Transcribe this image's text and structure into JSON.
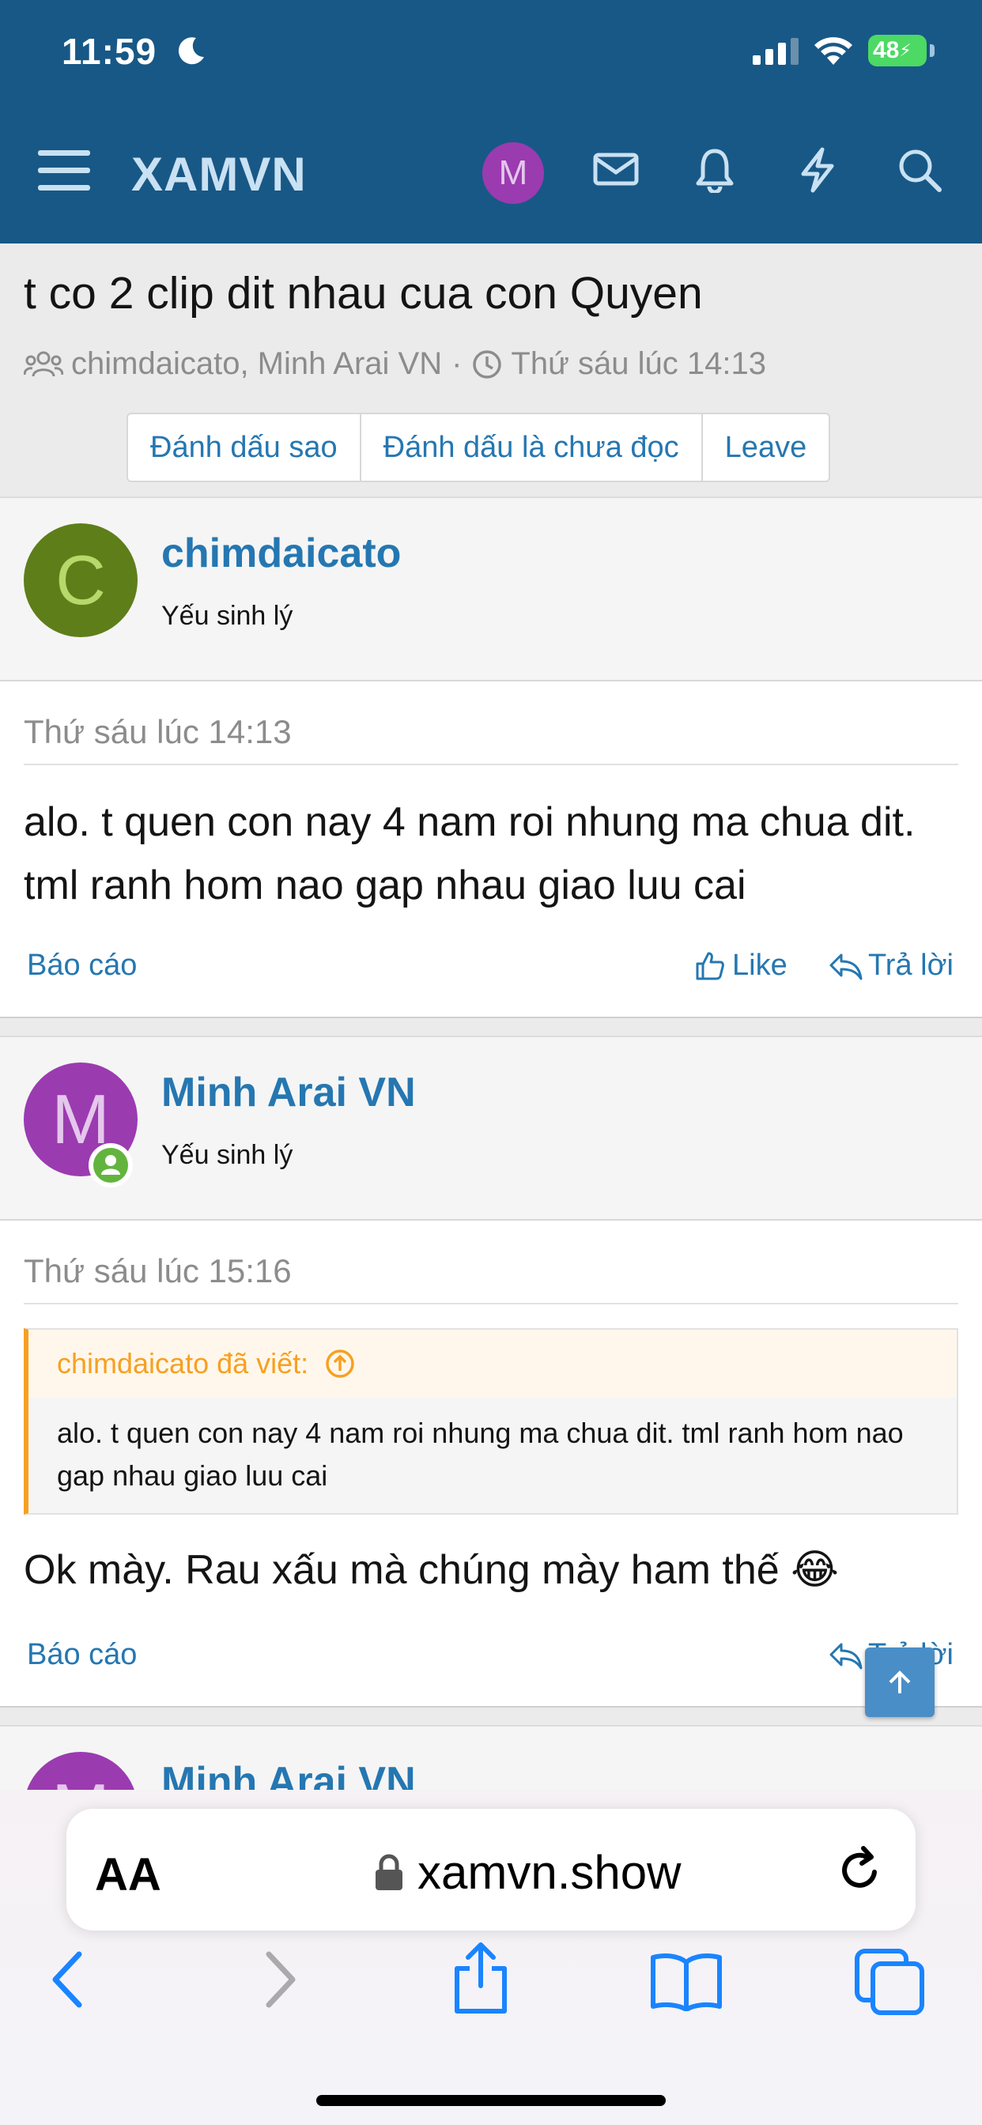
{
  "status": {
    "time": "11:59",
    "battery": "48"
  },
  "nav": {
    "logo": "XAMVN",
    "avatar_letter": "M"
  },
  "thread": {
    "title": "t co 2 clip dit nhau cua con Quyen",
    "participants": "chimdaicato, Minh Arai VN",
    "date": "Thứ sáu lúc 14:13",
    "buttons": [
      "Đánh dấu sao",
      "Đánh dấu là chưa đọc",
      "Leave"
    ]
  },
  "posts": [
    {
      "avatar_letter": "C",
      "username": "chimdaicato",
      "user_title": "Yếu sinh lý",
      "date": "Thứ sáu lúc 14:13",
      "text": "alo. t quen con nay 4 nam roi nhung ma chua dit. tml ranh hom nao gap nhau giao luu cai",
      "report": "Báo cáo",
      "like": "Like",
      "reply": "Trả lời"
    },
    {
      "avatar_letter": "M",
      "username": "Minh Arai VN",
      "user_title": "Yếu sinh lý",
      "date": "Thứ sáu lúc 15:16",
      "quote_author": "chimdaicato đã viết:",
      "quote_text": "alo. t quen con nay 4 nam roi nhung ma chua dit. tml ranh hom nao gap nhau giao luu cai",
      "text": "Ok mày. Rau xấu mà chúng mày ham thế 😂",
      "report": "Báo cáo",
      "reply": "Trả lời"
    },
    {
      "avatar_letter": "M",
      "username": "Minh Arai VN"
    }
  ],
  "browser": {
    "aa_label": "AA",
    "url": "xamvn.show"
  },
  "colors": {
    "header": "#185886",
    "link": "#2577b1",
    "quote_accent": "#f7a021"
  }
}
